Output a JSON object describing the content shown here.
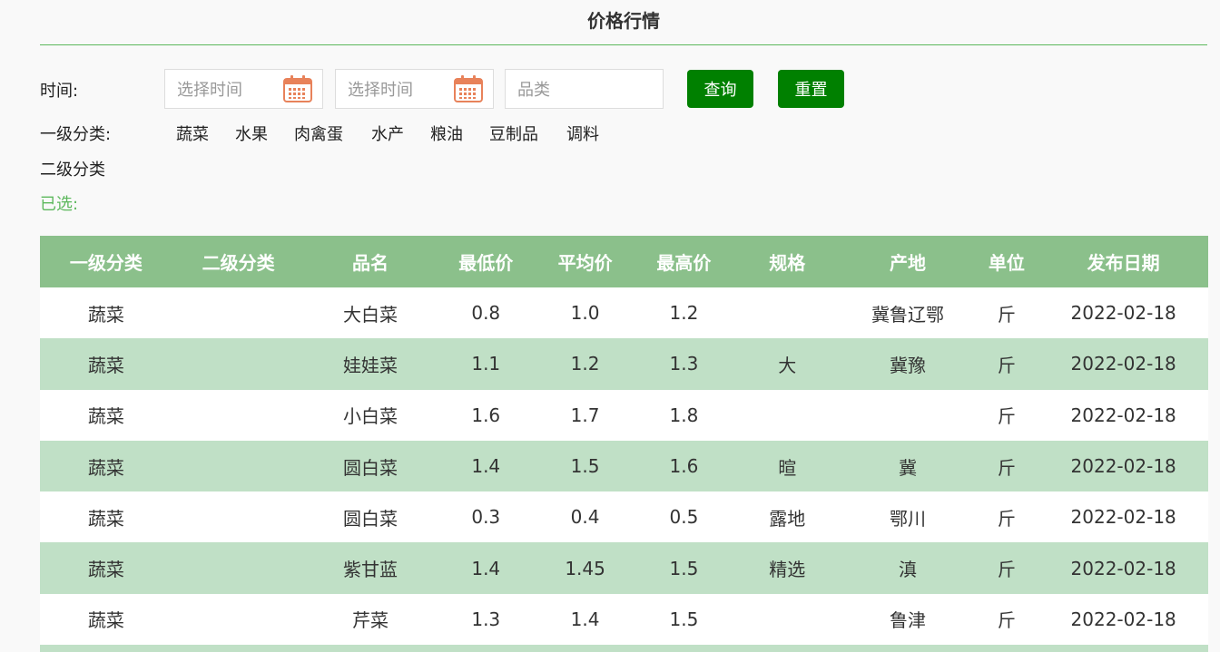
{
  "page": {
    "title": "价格行情"
  },
  "filters": {
    "time_label": "时间:",
    "start_placeholder": "选择时间",
    "end_placeholder": "选择时间",
    "category_placeholder": "品类",
    "query_label": "查询",
    "reset_label": "重置",
    "level1_label": "一级分类:",
    "level2_label": "二级分类",
    "selected_label": "已选:",
    "level1_items": [
      "蔬菜",
      "水果",
      "肉禽蛋",
      "水产",
      "粮油",
      "豆制品",
      "调料"
    ]
  },
  "colors": {
    "accent": "#008000",
    "header_bg": "#8bc08b",
    "row_alt": "#c0e0c6",
    "calendar_icon": "#e8825a"
  },
  "table": {
    "headers": [
      "一级分类",
      "二级分类",
      "品名",
      "最低价",
      "平均价",
      "最高价",
      "规格",
      "产地",
      "单位",
      "发布日期"
    ],
    "rows": [
      [
        "蔬菜",
        "",
        "大白菜",
        "0.8",
        "1.0",
        "1.2",
        "",
        "冀鲁辽鄂",
        "斤",
        "2022-02-18"
      ],
      [
        "蔬菜",
        "",
        "娃娃菜",
        "1.1",
        "1.2",
        "1.3",
        "大",
        "冀豫",
        "斤",
        "2022-02-18"
      ],
      [
        "蔬菜",
        "",
        "小白菜",
        "1.6",
        "1.7",
        "1.8",
        "",
        "",
        "斤",
        "2022-02-18"
      ],
      [
        "蔬菜",
        "",
        "圆白菜",
        "1.4",
        "1.5",
        "1.6",
        "暄",
        "冀",
        "斤",
        "2022-02-18"
      ],
      [
        "蔬菜",
        "",
        "圆白菜",
        "0.3",
        "0.4",
        "0.5",
        "露地",
        "鄂川",
        "斤",
        "2022-02-18"
      ],
      [
        "蔬菜",
        "",
        "紫甘蓝",
        "1.4",
        "1.45",
        "1.5",
        "精选",
        "滇",
        "斤",
        "2022-02-18"
      ],
      [
        "蔬菜",
        "",
        "芹菜",
        "1.3",
        "1.4",
        "1.5",
        "",
        "鲁津",
        "斤",
        "2022-02-18"
      ]
    ]
  }
}
